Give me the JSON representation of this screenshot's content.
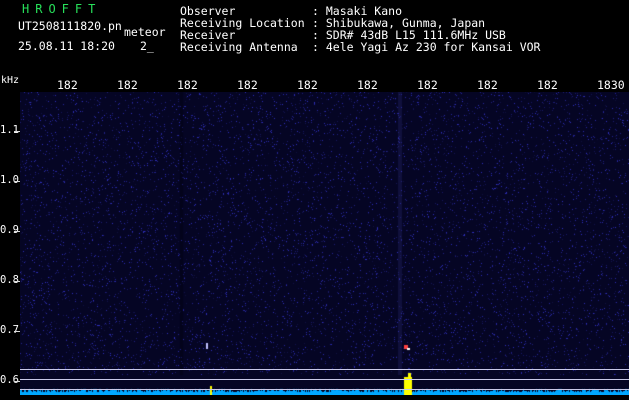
{
  "app": {
    "title": "HROFFT"
  },
  "file": {
    "name": "UT2508111820.pn",
    "label": "meteor",
    "datetime": "25.08.11 18:20",
    "index": "2_"
  },
  "meta": {
    "rows": [
      {
        "key": "Observer",
        "value": ": Masaki Kano"
      },
      {
        "key": "Receiving Location",
        "value": ": Shibukawa, Gunma, Japan"
      },
      {
        "key": "Receiver",
        "value": ": SDR# 43dB L15 111.6MHz USB"
      },
      {
        "key": "Receiving Antenna",
        "value": ": 4ele Yagi Az 230 for Kansai VOR"
      }
    ]
  },
  "axis": {
    "unit": "kHz",
    "freq_labels": [
      "182",
      "182",
      "182",
      "182",
      "182",
      "182",
      "182",
      "182",
      "182",
      "182",
      "1830"
    ],
    "y_labels": [
      "1.1",
      "1.0",
      "0.9",
      "0.8",
      "0.7",
      "0.6"
    ]
  },
  "colors": {
    "background": "#000000",
    "title": "#27e05a",
    "noise": "#00a8ff",
    "echo": "#ffff00"
  }
}
